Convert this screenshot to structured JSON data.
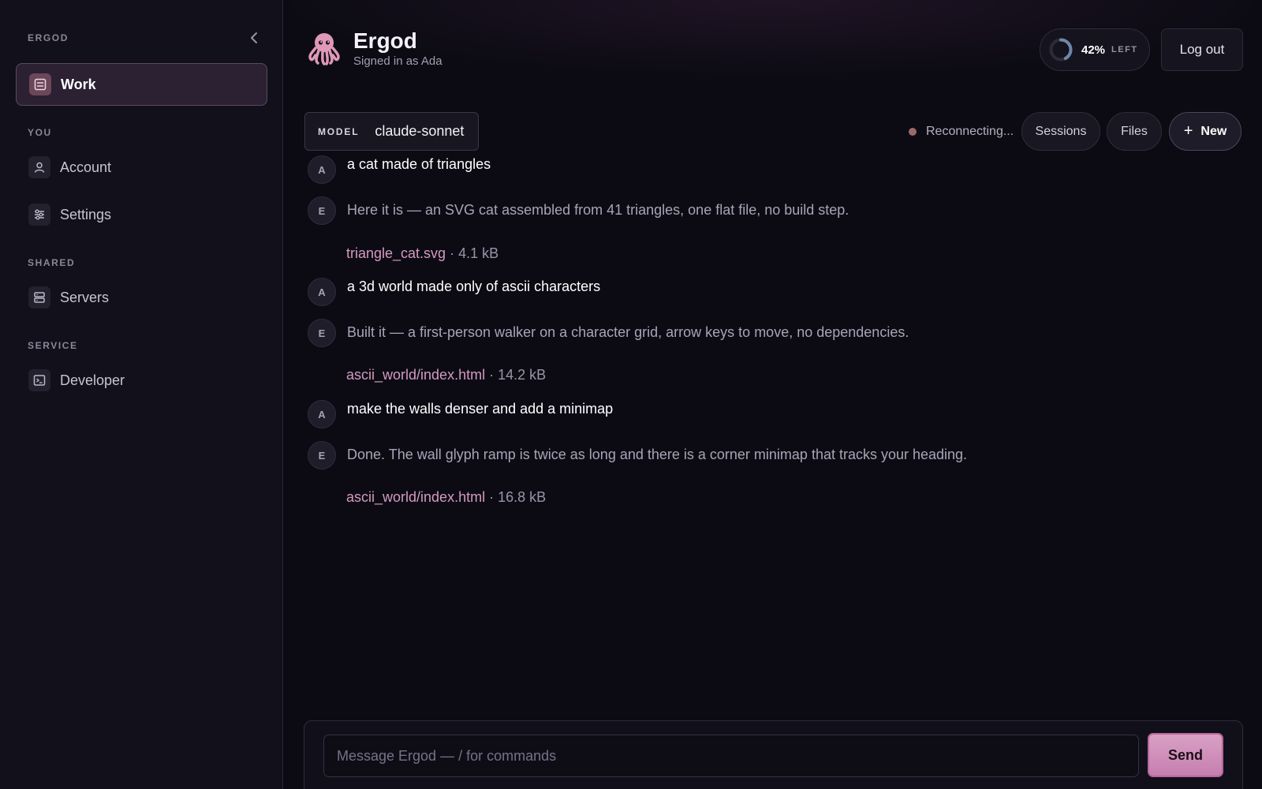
{
  "sidebar": {
    "brand": "ERGOD",
    "collapse_icon": "chevron-left-icon",
    "sections": {
      "you": "YOU",
      "shared": "SHARED",
      "service": "SERVICE"
    },
    "items": [
      {
        "label": "Work",
        "icon": "list-icon",
        "active": true
      },
      {
        "label": "Account",
        "icon": "user-icon"
      },
      {
        "label": "Settings",
        "icon": "sliders-icon"
      },
      {
        "label": "Servers",
        "icon": "server-icon"
      },
      {
        "label": "Developer",
        "icon": "terminal-icon"
      }
    ]
  },
  "header": {
    "logo_icon": "octopus-icon",
    "title": "Ergod",
    "subtitle": "Signed in as Ada",
    "quota": {
      "percent_text": "42%",
      "remaining_fraction": 0.42,
      "label": "LEFT"
    },
    "logout_label": "Log out"
  },
  "toolbar": {
    "model_label": "MODEL",
    "model_value": "claude-sonnet",
    "status_text": "Reconnecting...",
    "status_color": "#9a6a6a",
    "sessions_label": "Sessions",
    "files_label": "Files",
    "new_label": "New"
  },
  "messages": [
    {
      "role": "user",
      "avatar": "A",
      "text": "a cat made of triangles"
    },
    {
      "role": "agent",
      "avatar": "E",
      "text": "Here it is — an SVG cat assembled from 41 triangles, one flat file, no build step.",
      "file": "triangle_cat.svg",
      "size": "· 4.1 kB"
    },
    {
      "role": "user",
      "avatar": "A",
      "text": "a 3d world made only of ascii characters"
    },
    {
      "role": "agent",
      "avatar": "E",
      "text": "Built it — a first-person walker on a character grid, arrow keys to move, no dependencies.",
      "file": "ascii_world/index.html",
      "size": "· 14.2 kB"
    },
    {
      "role": "user",
      "avatar": "A",
      "text": "make the walls denser and add a minimap"
    },
    {
      "role": "agent",
      "avatar": "E",
      "text": "Done. The wall glyph ramp is twice as long and there is a corner minimap that tracks your heading.",
      "file": "ascii_world/index.html",
      "size": "· 16.8 kB"
    }
  ],
  "composer": {
    "placeholder": "Message Ergod — / for commands",
    "value": "",
    "send_label": "Send"
  },
  "colors": {
    "accent": "#d49ac0",
    "send": "#d9a0c4",
    "background": "#0c0b14",
    "sidebar": "#11101b"
  }
}
